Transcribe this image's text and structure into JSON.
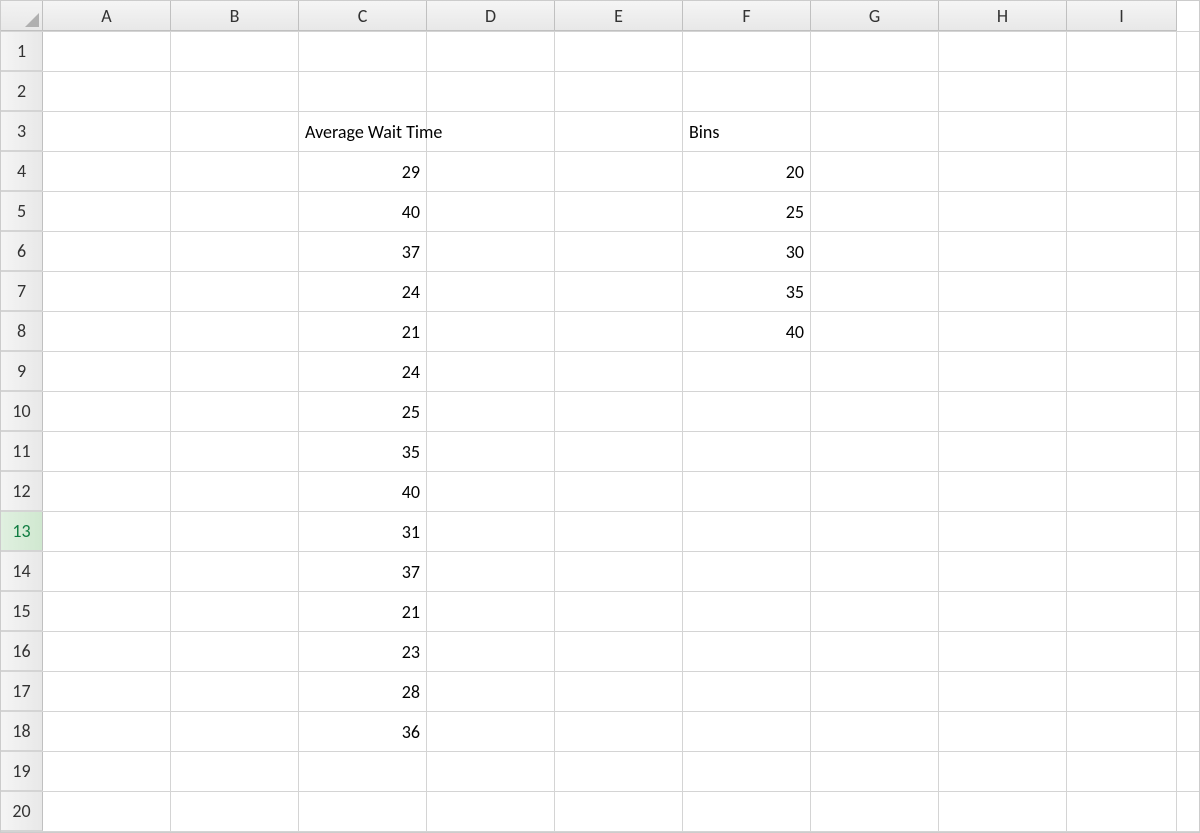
{
  "columns": [
    "A",
    "B",
    "C",
    "D",
    "E",
    "F",
    "G",
    "H",
    "I"
  ],
  "rowCount": 20,
  "selectedRow": 13,
  "cells": {
    "C3": {
      "value": "Average Wait Time",
      "type": "text",
      "overflow": true
    },
    "F3": {
      "value": "Bins",
      "type": "text"
    },
    "C4": {
      "value": "29",
      "type": "number"
    },
    "C5": {
      "value": "40",
      "type": "number"
    },
    "C6": {
      "value": "37",
      "type": "number"
    },
    "C7": {
      "value": "24",
      "type": "number"
    },
    "C8": {
      "value": "21",
      "type": "number"
    },
    "C9": {
      "value": "24",
      "type": "number"
    },
    "C10": {
      "value": "25",
      "type": "number"
    },
    "C11": {
      "value": "35",
      "type": "number"
    },
    "C12": {
      "value": "40",
      "type": "number"
    },
    "C13": {
      "value": "31",
      "type": "number"
    },
    "C14": {
      "value": "37",
      "type": "number"
    },
    "C15": {
      "value": "21",
      "type": "number"
    },
    "C16": {
      "value": "23",
      "type": "number"
    },
    "C17": {
      "value": "28",
      "type": "number"
    },
    "C18": {
      "value": "36",
      "type": "number"
    },
    "F4": {
      "value": "20",
      "type": "number"
    },
    "F5": {
      "value": "25",
      "type": "number"
    },
    "F6": {
      "value": "30",
      "type": "number"
    },
    "F7": {
      "value": "35",
      "type": "number"
    },
    "F8": {
      "value": "40",
      "type": "number"
    }
  }
}
